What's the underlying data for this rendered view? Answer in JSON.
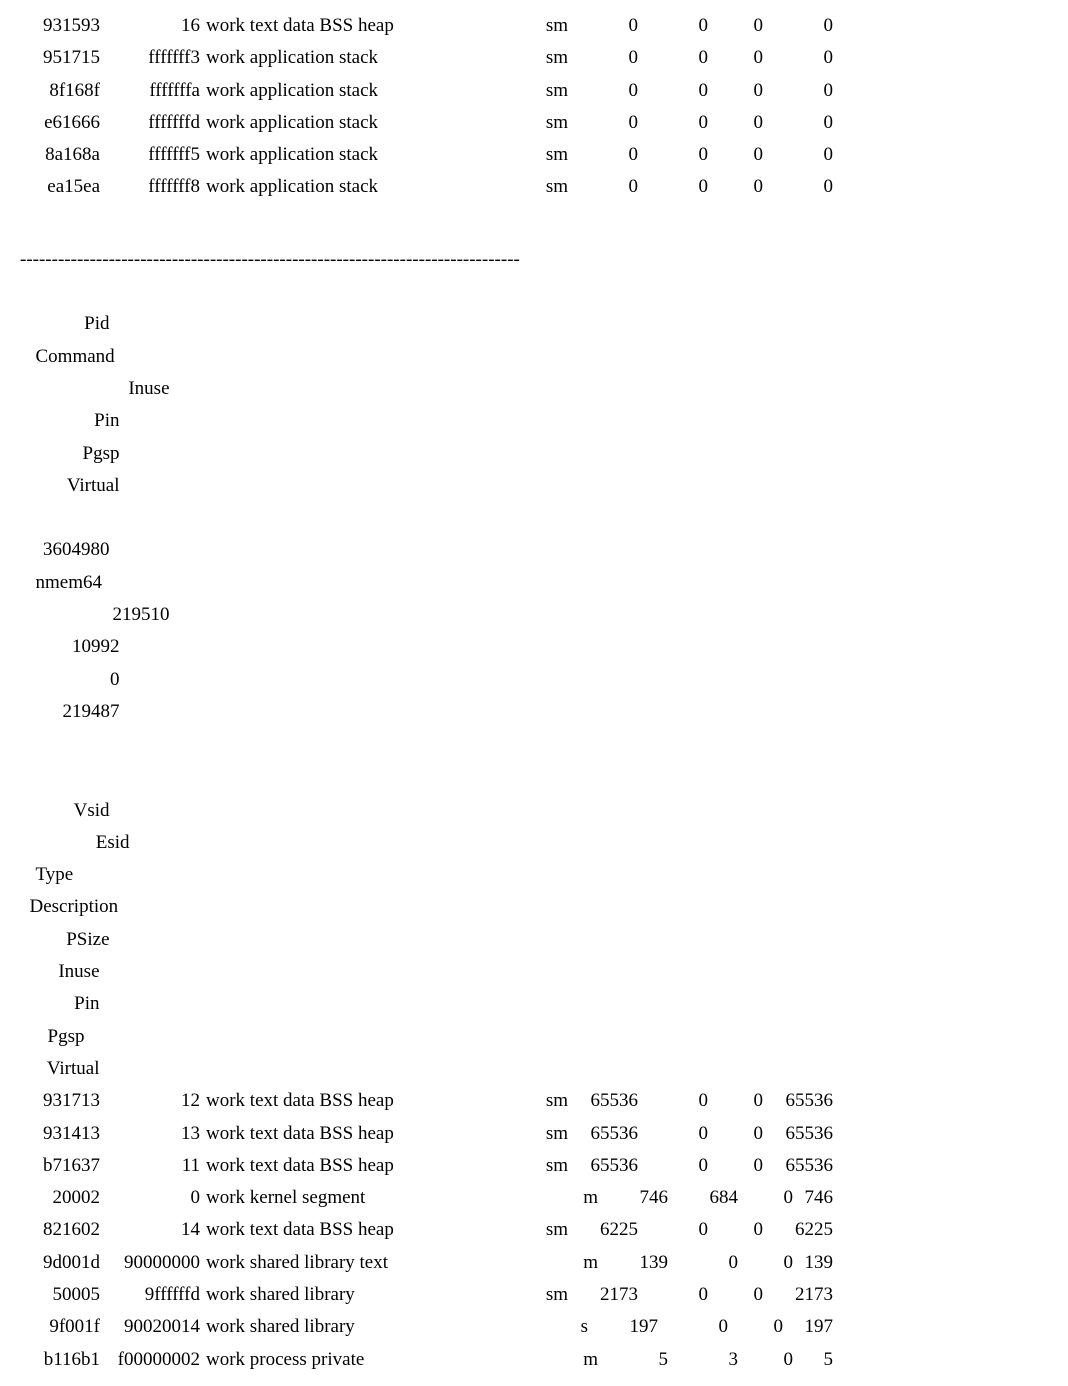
{
  "topRows": [
    {
      "vsid": "931593",
      "esid": "16",
      "desc": "work text data BSS heap",
      "psize": "sm",
      "inuse": "0",
      "pin": "0",
      "pgsp": "0",
      "virt": "0"
    },
    {
      "vsid": "951715",
      "esid": "fffffff3",
      "desc": "work application stack",
      "psize": "sm",
      "inuse": "0",
      "pin": "0",
      "pgsp": "0",
      "virt": "0"
    },
    {
      "vsid": "8f168f",
      "esid": "fffffffa",
      "desc": "work application stack",
      "psize": "sm",
      "inuse": "0",
      "pin": "0",
      "pgsp": "0",
      "virt": "0"
    },
    {
      "vsid": "e61666",
      "esid": "fffffffd",
      "desc": "work application stack",
      "psize": "sm",
      "inuse": "0",
      "pin": "0",
      "pgsp": "0",
      "virt": "0"
    },
    {
      "vsid": "8a168a",
      "esid": "fffffff5",
      "desc": "work application stack",
      "psize": "sm",
      "inuse": "0",
      "pin": "0",
      "pgsp": "0",
      "virt": "0"
    },
    {
      "vsid": "ea15ea",
      "esid": "fffffff8",
      "desc": "work application stack",
      "psize": "sm",
      "inuse": "0",
      "pin": "0",
      "pgsp": "0",
      "virt": "0"
    }
  ],
  "divider": "-------------------------------------------------------------------------------",
  "summaryHeader": {
    "pid": "Pid",
    "command": "Command",
    "inuse": "Inuse",
    "pin": "Pin",
    "pgsp": "Pgsp",
    "virt": "Virtual"
  },
  "summaryRow": {
    "pid": "3604980",
    "command": "nmem64",
    "inuse": "219510",
    "pin": "10992",
    "pgsp": "0",
    "virt": "219487"
  },
  "detailHeader": {
    "vsid": "Vsid",
    "esid": "Esid",
    "type": "Type",
    "desc": "Description",
    "psize": "PSize",
    "inuse": "Inuse",
    "pin": "Pin",
    "pgsp": "Pgsp",
    "virt": "Virtual"
  },
  "detailRows": [
    {
      "vsid": "931713",
      "esid": "12",
      "desc": "work text data BSS heap",
      "psize": "sm",
      "inuse": "65536",
      "pin": "0",
      "pgsp": "0",
      "virt": "65536"
    },
    {
      "vsid": "931413",
      "esid": "13",
      "desc": "work text data BSS heap",
      "psize": "sm",
      "inuse": "65536",
      "pin": "0",
      "pgsp": "0",
      "virt": "65536"
    },
    {
      "vsid": "b71637",
      "esid": "11",
      "desc": "work text data BSS heap",
      "psize": "sm",
      "inuse": "65536",
      "pin": "0",
      "pgsp": "0",
      "virt": "65536"
    },
    {
      "vsid": "20002",
      "esid": "0",
      "desc": "work kernel segment",
      "psize": "m",
      "inuse": "746",
      "pin": "684",
      "pgsp": "0",
      "virt": "746"
    },
    {
      "vsid": "821602",
      "esid": "14",
      "desc": "work text data BSS heap",
      "psize": "sm",
      "inuse": "6225",
      "pin": "0",
      "pgsp": "0",
      "virt": "6225"
    },
    {
      "vsid": "9d001d",
      "esid": "90000000",
      "desc": "work shared library text",
      "psize": "m",
      "inuse": "139",
      "pin": "0",
      "pgsp": "0",
      "virt": "139"
    },
    {
      "vsid": "50005",
      "esid": "9ffffffd",
      "desc": "work shared library",
      "psize": "sm",
      "inuse": "2173",
      "pin": "0",
      "pgsp": "0",
      "virt": "2173"
    },
    {
      "vsid": "9f001f",
      "esid": "90020014",
      "desc": "work shared library",
      "psize": "s",
      "inuse": "197",
      "pin": "0",
      "pgsp": "0",
      "virt": "197"
    },
    {
      "vsid": "b116b1",
      "esid": "f00000002",
      "desc": "work process private",
      "psize": "m",
      "inuse": "5",
      "pin": "3",
      "pgsp": "0",
      "virt": "5"
    }
  ]
}
